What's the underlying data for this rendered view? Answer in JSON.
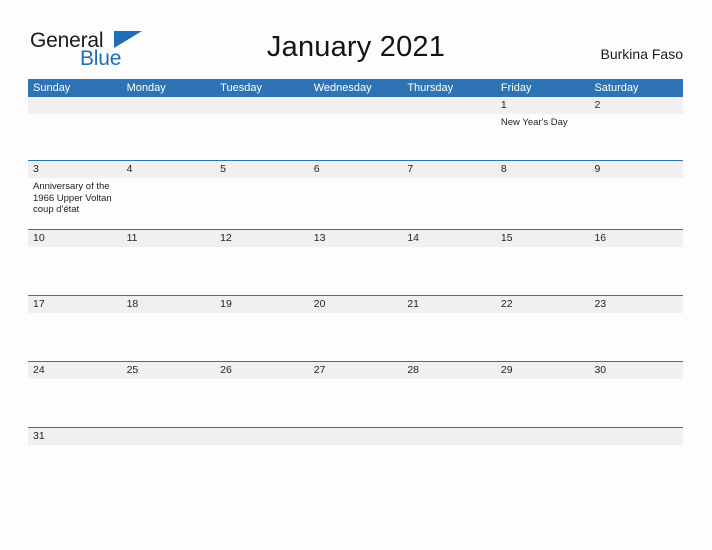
{
  "brand": {
    "name_part1": "General",
    "name_part2": "Blue",
    "flag_icon": "blue-triangle-flag",
    "colors": {
      "dark": "#1a1a1a",
      "blue": "#1f6fb5"
    }
  },
  "header": {
    "title": "January 2021",
    "country": "Burkina Faso"
  },
  "calendar": {
    "colors": {
      "header_blue": "#2e74b5",
      "row_band_gray": "#f0f0f0",
      "grid_line": "#2e74b5",
      "text": "#222222"
    },
    "day_headers": [
      "Sunday",
      "Monday",
      "Tuesday",
      "Wednesday",
      "Thursday",
      "Friday",
      "Saturday"
    ],
    "weeks": [
      {
        "days": [
          {
            "num": "",
            "events": []
          },
          {
            "num": "",
            "events": []
          },
          {
            "num": "",
            "events": []
          },
          {
            "num": "",
            "events": []
          },
          {
            "num": "",
            "events": []
          },
          {
            "num": "1",
            "events": [
              "New Year's Day"
            ]
          },
          {
            "num": "2",
            "events": []
          }
        ]
      },
      {
        "days": [
          {
            "num": "3",
            "events": [
              "Anniversary of the 1966 Upper Voltan coup d'état"
            ]
          },
          {
            "num": "4",
            "events": []
          },
          {
            "num": "5",
            "events": []
          },
          {
            "num": "6",
            "events": []
          },
          {
            "num": "7",
            "events": []
          },
          {
            "num": "8",
            "events": []
          },
          {
            "num": "9",
            "events": []
          }
        ]
      },
      {
        "days": [
          {
            "num": "10",
            "events": []
          },
          {
            "num": "11",
            "events": []
          },
          {
            "num": "12",
            "events": []
          },
          {
            "num": "13",
            "events": []
          },
          {
            "num": "14",
            "events": []
          },
          {
            "num": "15",
            "events": []
          },
          {
            "num": "16",
            "events": []
          }
        ]
      },
      {
        "days": [
          {
            "num": "17",
            "events": []
          },
          {
            "num": "18",
            "events": []
          },
          {
            "num": "19",
            "events": []
          },
          {
            "num": "20",
            "events": []
          },
          {
            "num": "21",
            "events": []
          },
          {
            "num": "22",
            "events": []
          },
          {
            "num": "23",
            "events": []
          }
        ]
      },
      {
        "days": [
          {
            "num": "24",
            "events": []
          },
          {
            "num": "25",
            "events": []
          },
          {
            "num": "26",
            "events": []
          },
          {
            "num": "27",
            "events": []
          },
          {
            "num": "28",
            "events": []
          },
          {
            "num": "29",
            "events": []
          },
          {
            "num": "30",
            "events": []
          }
        ]
      },
      {
        "days": [
          {
            "num": "31",
            "events": []
          },
          {
            "num": "",
            "events": []
          },
          {
            "num": "",
            "events": []
          },
          {
            "num": "",
            "events": []
          },
          {
            "num": "",
            "events": []
          },
          {
            "num": "",
            "events": []
          },
          {
            "num": "",
            "events": []
          }
        ]
      }
    ],
    "week_body_heights": [
      46,
      51,
      48,
      48,
      48,
      12
    ]
  }
}
